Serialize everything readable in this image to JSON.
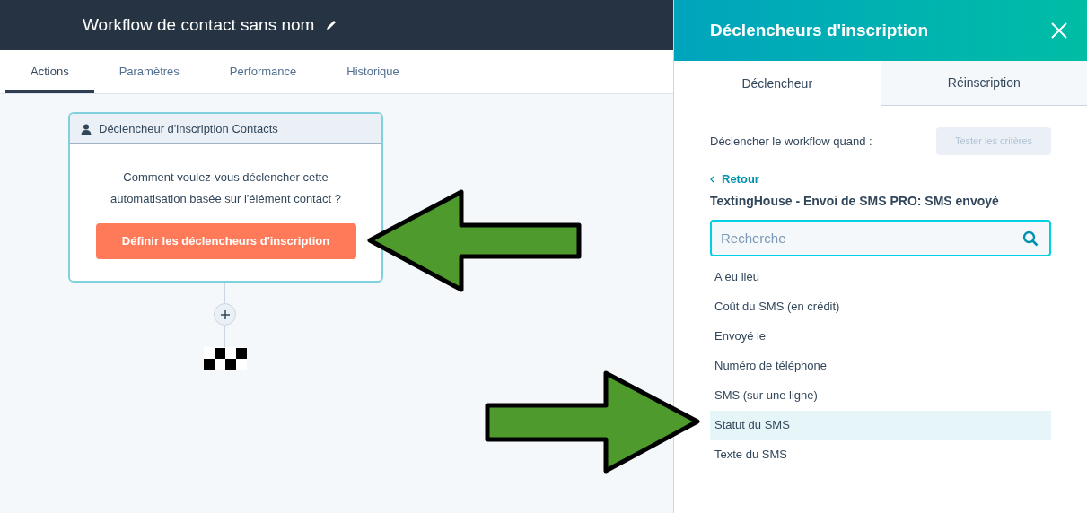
{
  "header": {
    "title": "Workflow de contact sans nom"
  },
  "tabs": [
    {
      "label": "Actions",
      "selected": true
    },
    {
      "label": "Paramètres",
      "selected": false
    },
    {
      "label": "Performance",
      "selected": false
    },
    {
      "label": "Historique",
      "selected": false
    }
  ],
  "trigger_card": {
    "title": "Déclencheur d'inscription Contacts",
    "text": "Comment voulez-vous déclencher cette automatisation basée sur l'élément contact ?",
    "button": "Définir les déclencheurs d'inscription"
  },
  "panel": {
    "title": "Déclencheurs d'inscription",
    "tabs": [
      {
        "label": "Déclencheur",
        "selected": true
      },
      {
        "label": "Réinscription",
        "selected": false
      }
    ],
    "prompt": "Déclencher le workflow quand :",
    "test_button": {
      "label": "Tester les critères",
      "disabled": true
    },
    "back_link": "Retour",
    "event_title": "TextingHouse - Envoi de SMS PRO: SMS envoyé",
    "search": {
      "placeholder": "Recherche"
    },
    "properties": [
      {
        "label": "A eu lieu",
        "selected": false
      },
      {
        "label": "Coût du SMS (en crédit)",
        "selected": false
      },
      {
        "label": "Envoyé le",
        "selected": false
      },
      {
        "label": "Numéro de téléphone",
        "selected": false
      },
      {
        "label": "SMS (sur une ligne)",
        "selected": false
      },
      {
        "label": "Statut du SMS",
        "selected": true
      },
      {
        "label": "Texte du SMS",
        "selected": false
      }
    ]
  },
  "annotations": [
    {
      "kind": "arrow-left"
    },
    {
      "kind": "arrow-right"
    }
  ]
}
